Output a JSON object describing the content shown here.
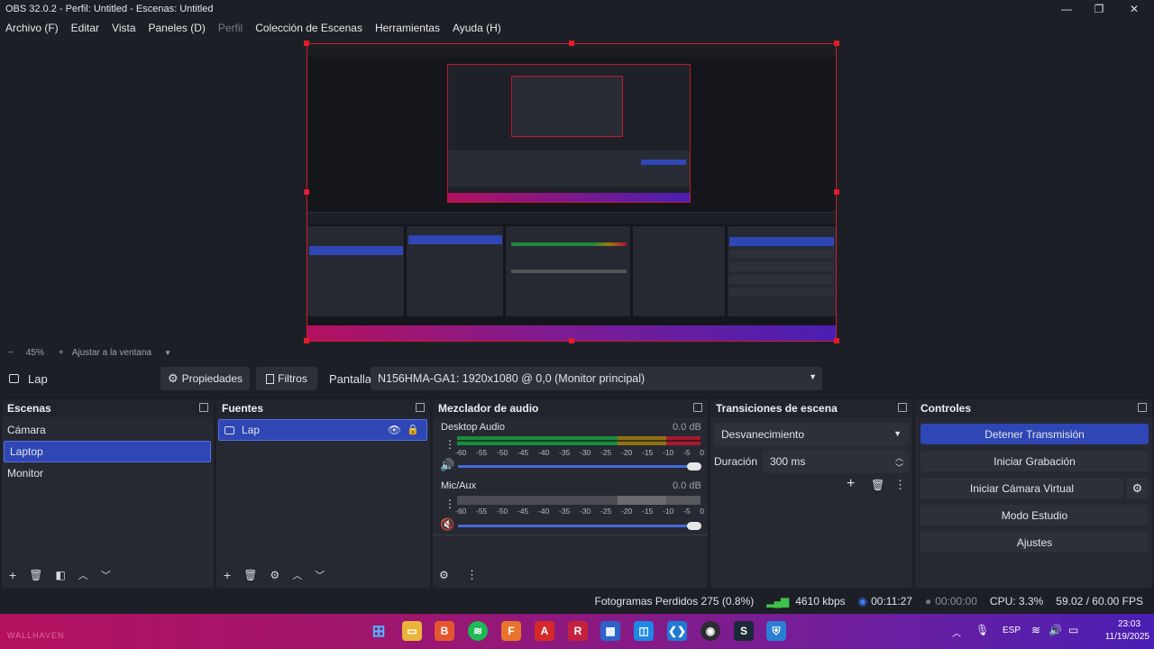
{
  "window": {
    "title": "OBS 32.0.2 - Perfil: Untitled - Escenas: Untitled",
    "min": "—",
    "max": "❐",
    "close": "✕"
  },
  "menu": [
    "Archivo (F)",
    "Editar",
    "Vista",
    "Paneles (D)",
    "Perfil",
    "Colección de Escenas",
    "Herramientas",
    "Ayuda (H)"
  ],
  "zoom": {
    "minus": "−",
    "value": "45%",
    "plus": "+",
    "fit": "Ajustar a la ventana",
    "caret": "▼"
  },
  "source_bar": {
    "source_name": "Lap",
    "properties": "Propiedades",
    "filters": "Filtros",
    "display_label": "Pantalla",
    "display_value": "N156HMA-GA1: 1920x1080 @ 0,0 (Monitor principal)"
  },
  "scenes": {
    "title": "Escenas",
    "items": [
      "Cámara",
      "Laptop",
      "Monitor"
    ],
    "selected": 1
  },
  "sources": {
    "title": "Fuentes",
    "items": [
      "Lap"
    ]
  },
  "mixer": {
    "title": "Mezclador de audio",
    "channels": [
      {
        "name": "Desktop Audio",
        "db": "0.0 dB"
      },
      {
        "name": "Mic/Aux",
        "db": "0.0 dB"
      }
    ],
    "ticks": [
      "-60",
      "-55",
      "-50",
      "-45",
      "-40",
      "-35",
      "-30",
      "-25",
      "-20",
      "-15",
      "-10",
      "-5",
      "0"
    ]
  },
  "transitions": {
    "title": "Transiciones de escena",
    "selected": "Desvanecimiento",
    "duration_label": "Duración",
    "duration_value": "300 ms"
  },
  "controls": {
    "title": "Controles",
    "stop_stream": "Detener Transmisión",
    "start_record": "Iniciar Grabación",
    "virtual_cam": "Iniciar Cámara Virtual",
    "studio": "Modo Estudio",
    "settings": "Ajustes"
  },
  "status": {
    "dropped": "Fotogramas Perdidos 275 (0.8%)",
    "bitrate": "4610 kbps",
    "stream_time": "00:11:27",
    "rec_time": "00:00:00",
    "cpu": "CPU: 3.3%",
    "fps": "59.02 / 60.00 FPS"
  },
  "taskbar": {
    "lang": "ESP",
    "time": "23:03",
    "date": "11/19/2025",
    "wallpaper": "WALLHAVEN"
  },
  "colors": {
    "accent": "#2f46b5",
    "selection_border": "#d11c2c",
    "taskbar_start": "#b3115f",
    "taskbar_end": "#4a1fb3"
  }
}
